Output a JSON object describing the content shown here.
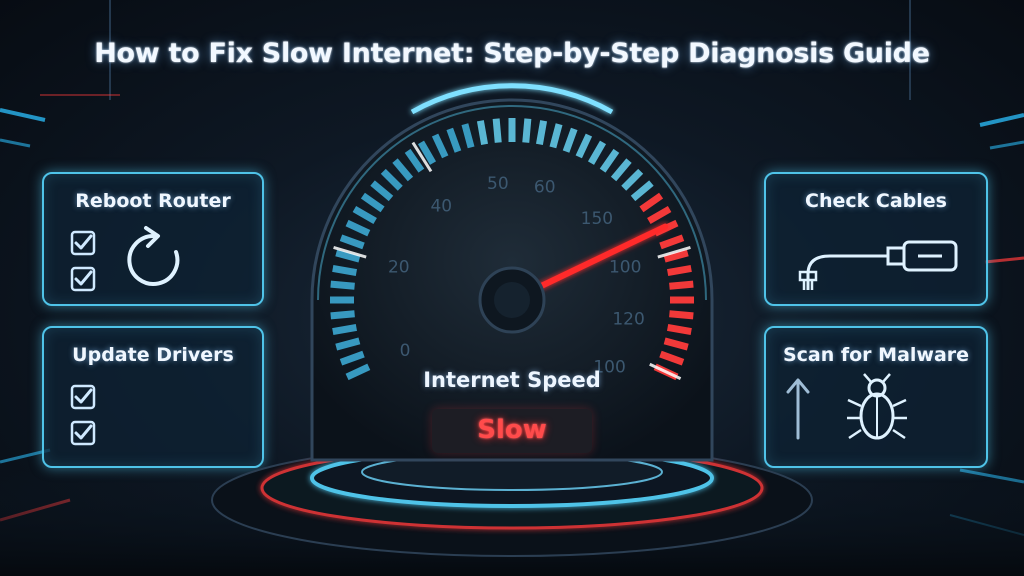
{
  "title": "How to Fix Slow Internet: Step-by-Step Diagnosis Guide",
  "cards": {
    "reboot_router": "Reboot Router",
    "update_drivers": "Update Drivers",
    "check_cables": "Check Cables",
    "scan_malware": "Scan for Malware"
  },
  "gauge": {
    "label": "Internet Speed",
    "status": "Slow",
    "scale_labels": [
      "0",
      "20",
      "40",
      "50",
      "60",
      "150",
      "100",
      "120",
      "100"
    ],
    "needle_position": 0.78
  },
  "colors": {
    "accent": "#4fc3e8",
    "danger": "#ff3b3b",
    "background": "#0e1824"
  },
  "icons": [
    "reboot-icon",
    "checkbox-icon",
    "cable-plug-icon",
    "upload-arrow-icon",
    "bug-icon"
  ]
}
